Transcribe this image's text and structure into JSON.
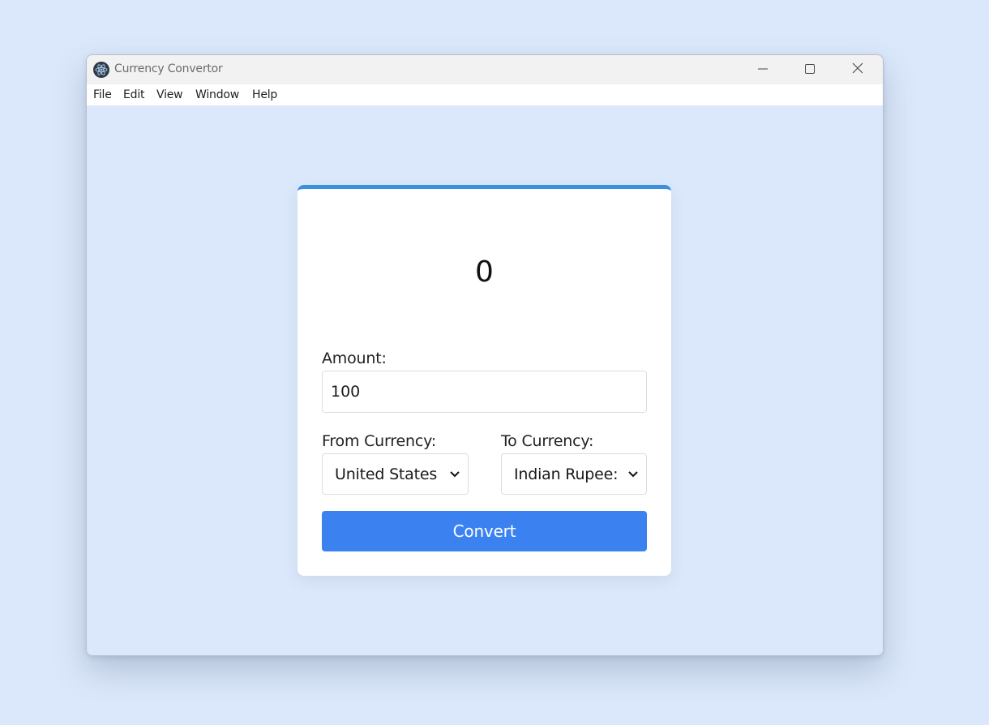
{
  "window": {
    "title": "Currency Convertor"
  },
  "menu": {
    "items": [
      "File",
      "Edit",
      "View",
      "Window",
      "Help"
    ]
  },
  "converter": {
    "result": "0",
    "amount_label": "Amount:",
    "amount_value": "100",
    "from_label": "From Currency:",
    "from_selected": "United States Dollar: USD",
    "to_label": "To Currency:",
    "to_selected": "Indian Rupee: INR",
    "convert_label": "Convert"
  },
  "icons": {
    "app": "electron-icon",
    "minimize": "minimize-icon",
    "maximize": "maximize-icon",
    "close": "close-icon",
    "dropdown": "chevron-down-icon"
  },
  "colors": {
    "background": "#dbe8fb",
    "accent_bar": "#3b8fdc",
    "button": "#3b82f0"
  }
}
